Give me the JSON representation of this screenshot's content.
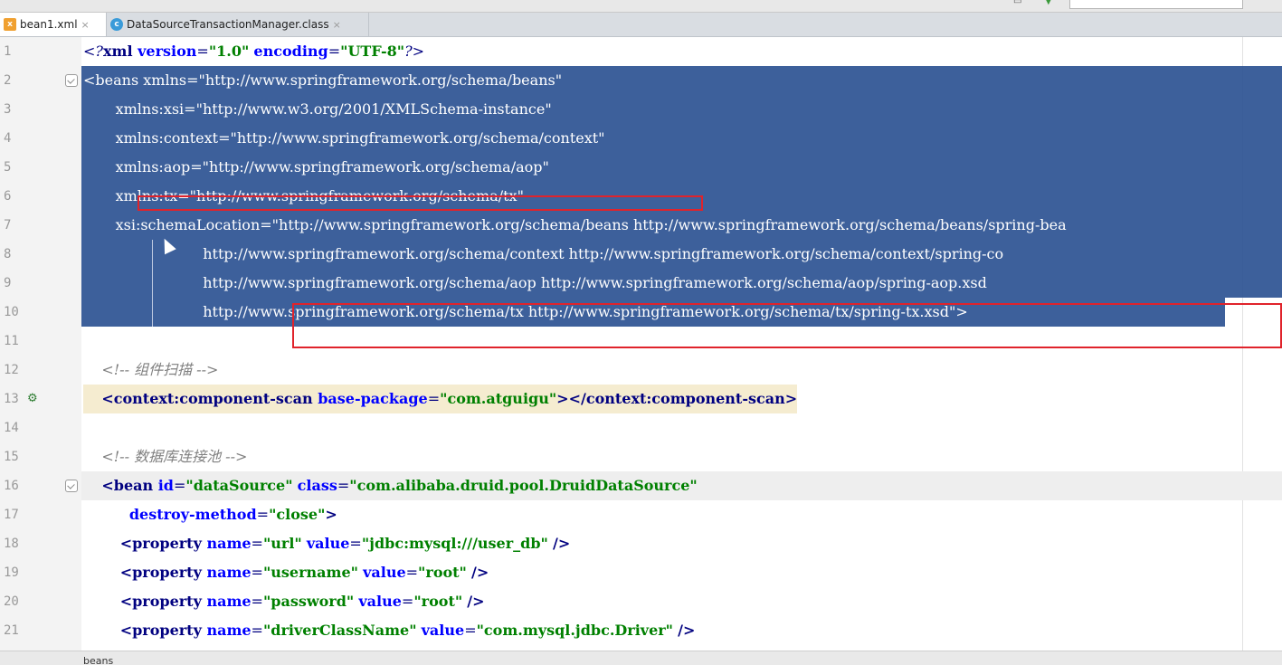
{
  "tabs": [
    {
      "label": "bean1.xml",
      "icon": "xml-file-icon",
      "active": true
    },
    {
      "label": "DataSourceTransactionManager.class",
      "icon": "class-file-icon",
      "active": false
    }
  ],
  "editor": {
    "lines": [
      {
        "num": "1",
        "text": "<?xml version=\"1.0\" encoding=\"UTF-8\"?>"
      },
      {
        "num": "2",
        "text": "<beans xmlns=\"http://www.springframework.org/schema/beans\""
      },
      {
        "num": "3",
        "text": "       xmlns:xsi=\"http://www.w3.org/2001/XMLSchema-instance\""
      },
      {
        "num": "4",
        "text": "       xmlns:context=\"http://www.springframework.org/schema/context\""
      },
      {
        "num": "5",
        "text": "       xmlns:aop=\"http://www.springframework.org/schema/aop\""
      },
      {
        "num": "6",
        "text": "       xmlns:tx=\"http://www.springframework.org/schema/tx\""
      },
      {
        "num": "7",
        "text": "       xsi:schemaLocation=\"http://www.springframework.org/schema/beans http://www.springframework.org/schema/beans/spring-bea"
      },
      {
        "num": "8",
        "text": "                          http://www.springframework.org/schema/context http://www.springframework.org/schema/context/spring-co"
      },
      {
        "num": "9",
        "text": "                          http://www.springframework.org/schema/aop http://www.springframework.org/schema/aop/spring-aop.xsd"
      },
      {
        "num": "10",
        "text": "                          http://www.springframework.org/schema/tx http://www.springframework.org/schema/tx/spring-tx.xsd\">"
      },
      {
        "num": "11",
        "text": ""
      },
      {
        "num": "12",
        "text": "    <!-- 组件扫描 -->"
      },
      {
        "num": "13",
        "text": "    <context:component-scan base-package=\"com.atguigu\"></context:component-scan>"
      },
      {
        "num": "14",
        "text": ""
      },
      {
        "num": "15",
        "text": "    <!-- 数据库连接池 -->"
      },
      {
        "num": "16",
        "text": "    <bean id=\"dataSource\" class=\"com.alibaba.druid.pool.DruidDataSource\""
      },
      {
        "num": "17",
        "text": "          destroy-method=\"close\">"
      },
      {
        "num": "18",
        "text": "        <property name=\"url\" value=\"jdbc:mysql:///user_db\" />"
      },
      {
        "num": "19",
        "text": "        <property name=\"username\" value=\"root\" />"
      },
      {
        "num": "20",
        "text": "        <property name=\"password\" value=\"root\" />"
      },
      {
        "num": "21",
        "text": "        <property name=\"driverClassName\" value=\"com.mysql.jdbc.Driver\" />"
      }
    ]
  },
  "statusbar": {
    "breadcrumb": "beans"
  },
  "colors": {
    "selection": "#2d5393",
    "annotation": "#e0232b",
    "tag": "#000080",
    "attribute": "#0000ff",
    "value": "#008000",
    "comment": "#808080"
  }
}
